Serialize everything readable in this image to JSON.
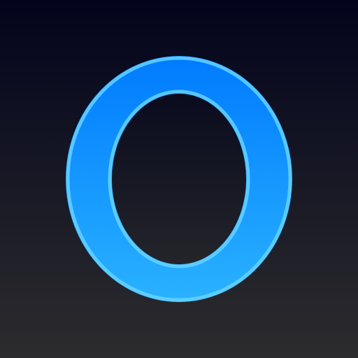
{
  "icon": {
    "name": "letter-o-app-icon",
    "glyph": "O",
    "colors": {
      "background_top": "#03041c",
      "background_bottom": "#2c2c2e",
      "ring_top": "#007bff",
      "ring_bottom": "#2ab2ff",
      "ring_highlight": "#66d2ff",
      "inner_fill": "#1a1a22"
    }
  }
}
